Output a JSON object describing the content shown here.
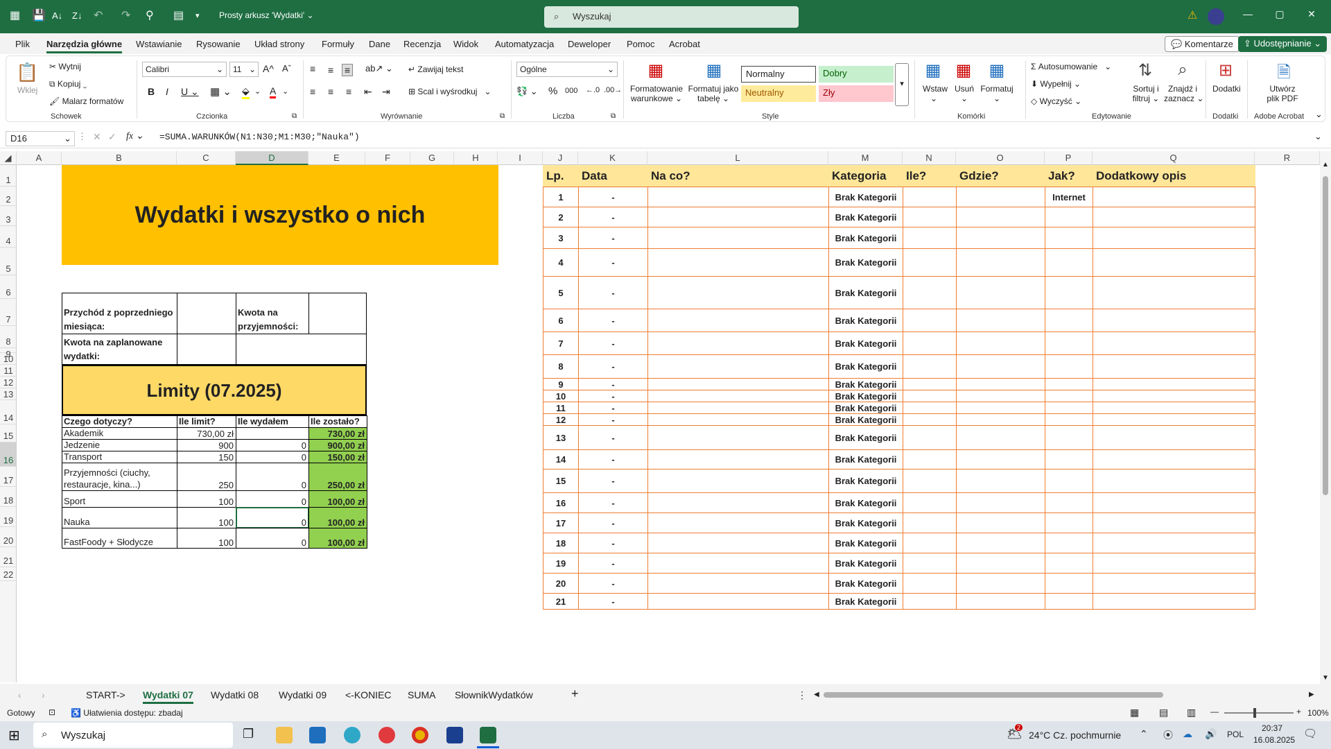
{
  "title_bar": {
    "doc_title": "Prosty arkusz 'Wydatki'",
    "search_placeholder": "Wyszukaj"
  },
  "menu": {
    "tabs": [
      "Plik",
      "Narzędzia główne",
      "Wstawianie",
      "Rysowanie",
      "Układ strony",
      "Formuły",
      "Dane",
      "Recenzja",
      "Widok",
      "Automatyzacja",
      "Deweloper",
      "Pomoc",
      "Acrobat"
    ],
    "comments": "Komentarze",
    "share": "Udostępnianie"
  },
  "ribbon": {
    "paste": "Wklej",
    "cut": "Wytnij",
    "copy": "Kopiuj",
    "painter": "Malarz formatów",
    "clipboard": "Schowek",
    "font_name": "Calibri",
    "font_size": "11",
    "font_group": "Czcionka",
    "wrap": "Zawijaj tekst",
    "merge": "Scal i wyśrodkuj",
    "align_group": "Wyrównanie",
    "number_format": "Ogólne",
    "number_group": "Liczba",
    "cond_format": "Formatowanie",
    "cond_format2": "warunkowe",
    "format_table": "Formatuj jako",
    "format_table2": "tabelę",
    "style_normal": "Normalny",
    "style_good": "Dobry",
    "style_neutral": "Neutralny",
    "style_bad": "Zły",
    "styles_group": "Style",
    "insert": "Wstaw",
    "delete": "Usuń",
    "format": "Formatuj",
    "cells_group": "Komórki",
    "autosum": "Autosumowanie",
    "fill": "Wypełnij",
    "clear": "Wyczyść",
    "sort": "Sortuj i",
    "sort2": "filtruj",
    "find": "Znajdź i",
    "find2": "zaznacz",
    "editing_group": "Edytowanie",
    "addins": "Dodatki",
    "addins_group": "Dodatki",
    "pdf": "Utwórz",
    "pdf2": "plik PDF",
    "acrobat_group": "Adobe Acrobat"
  },
  "formula_bar": {
    "cell": "D16",
    "formula": "=SUMA.WARUNKÓW(N1:N30;M1:M30;\"Nauka\")"
  },
  "columns": [
    "A",
    "B",
    "C",
    "D",
    "E",
    "F",
    "G",
    "H",
    "I",
    "J",
    "K",
    "L",
    "M",
    "N",
    "O",
    "P",
    "Q",
    "R"
  ],
  "rows": [
    "1",
    "2",
    "3",
    "4",
    "5",
    "6",
    "7",
    "8",
    "9",
    "10",
    "11",
    "12",
    "13",
    "14",
    "15",
    "16",
    "17",
    "18",
    "19",
    "20",
    "21",
    "22"
  ],
  "left": {
    "title": "Wydatki i wszystko o nich",
    "income_label": "Przychód z poprzedniego miesiąca:",
    "fun_label": "Kwota na przyjemności:",
    "planned_label": "Kwota na zaplanowane wydatki:",
    "limits_title": "Limity (07.2025)",
    "headers": [
      "Czego dotyczy?",
      "Ile limit?",
      "Ile wydałem",
      "Ile zostało?"
    ],
    "rows": [
      {
        "name": "Akademik",
        "limit": "730,00 zł",
        "spent": "",
        "left": "730,00 zł"
      },
      {
        "name": "Jedzenie",
        "limit": "900",
        "spent": "0",
        "left": "900,00 zł"
      },
      {
        "name": "Transport",
        "limit": "150",
        "spent": "0",
        "left": "150,00 zł"
      },
      {
        "name": "Przyjemności (ciuchy, restauracje, kina...)",
        "limit": "250",
        "spent": "0",
        "left": "250,00 zł"
      },
      {
        "name": "Sport",
        "limit": "100",
        "spent": "0",
        "left": "100,00 zł"
      },
      {
        "name": "Nauka",
        "limit": "100",
        "spent": "0",
        "left": "100,00 zł"
      },
      {
        "name": "FastFoody + Słodycze",
        "limit": "100",
        "spent": "0",
        "left": "100,00 zł"
      }
    ]
  },
  "right": {
    "headers": [
      "Lp.",
      "Data",
      "Na co?",
      "Kategoria",
      "Ile?",
      "Gdzie?",
      "Jak?",
      "Dodatkowy opis"
    ],
    "rows": [
      {
        "lp": "1",
        "data": "-",
        "kat": "Brak Kategorii",
        "jak": "Internet"
      },
      {
        "lp": "2",
        "data": "-",
        "kat": "Brak Kategorii",
        "jak": ""
      },
      {
        "lp": "3",
        "data": "-",
        "kat": "Brak Kategorii",
        "jak": ""
      },
      {
        "lp": "4",
        "data": "-",
        "kat": "Brak Kategorii",
        "jak": ""
      },
      {
        "lp": "5",
        "data": "-",
        "kat": "Brak Kategorii",
        "jak": ""
      },
      {
        "lp": "6",
        "data": "-",
        "kat": "Brak Kategorii",
        "jak": ""
      },
      {
        "lp": "7",
        "data": "-",
        "kat": "Brak Kategorii",
        "jak": ""
      },
      {
        "lp": "8",
        "data": "-",
        "kat": "Brak Kategorii",
        "jak": ""
      },
      {
        "lp": "9",
        "data": "-",
        "kat": "Brak Kategorii",
        "jak": ""
      },
      {
        "lp": "10",
        "data": "-",
        "kat": "Brak Kategorii",
        "jak": ""
      },
      {
        "lp": "11",
        "data": "-",
        "kat": "Brak Kategorii",
        "jak": ""
      },
      {
        "lp": "12",
        "data": "-",
        "kat": "Brak Kategorii",
        "jak": ""
      },
      {
        "lp": "13",
        "data": "-",
        "kat": "Brak Kategorii",
        "jak": ""
      },
      {
        "lp": "14",
        "data": "-",
        "kat": "Brak Kategorii",
        "jak": ""
      },
      {
        "lp": "15",
        "data": "-",
        "kat": "Brak Kategorii",
        "jak": ""
      },
      {
        "lp": "16",
        "data": "-",
        "kat": "Brak Kategorii",
        "jak": ""
      },
      {
        "lp": "17",
        "data": "-",
        "kat": "Brak Kategorii",
        "jak": ""
      },
      {
        "lp": "18",
        "data": "-",
        "kat": "Brak Kategorii",
        "jak": ""
      },
      {
        "lp": "19",
        "data": "-",
        "kat": "Brak Kategorii",
        "jak": ""
      },
      {
        "lp": "20",
        "data": "-",
        "kat": "Brak Kategorii",
        "jak": ""
      },
      {
        "lp": "21",
        "data": "-",
        "kat": "Brak Kategorii",
        "jak": ""
      }
    ]
  },
  "sheets": {
    "tabs": [
      "START->",
      "Wydatki 07",
      "Wydatki 08",
      "Wydatki 09",
      "<-KONIEC",
      "SUMA",
      "SłownikWydatków"
    ],
    "active": "Wydatki 07"
  },
  "status": {
    "ready": "Gotowy",
    "accessibility": "Ułatwienia dostępu: zbadaj",
    "zoom": "100%"
  },
  "taskbar": {
    "search": "Wyszukaj",
    "weather": "24°C  Cz. pochmurnie",
    "lang": "POL",
    "time": "20:37",
    "date": "16.08.2025",
    "badge": "2"
  },
  "colors": {
    "title_fill": "#ffc000",
    "limits_fill": "#ffd966",
    "remaining_fill": "#92d050",
    "header_fill": "#ffe699",
    "table_border": "#ed7d31",
    "excel_green": "#1e6e42"
  }
}
